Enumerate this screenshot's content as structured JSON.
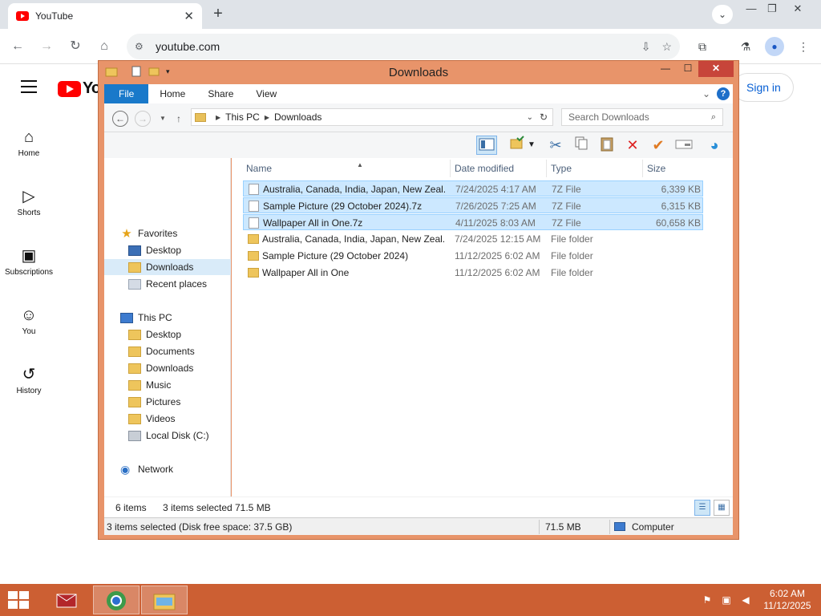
{
  "browser": {
    "tab_title": "YouTube",
    "url": "youtube.com"
  },
  "youtube": {
    "logo_text": "Yo",
    "sidebar": [
      {
        "icon": "home-icon",
        "label": "Home"
      },
      {
        "icon": "shorts-icon",
        "label": "Shorts"
      },
      {
        "icon": "subscriptions-icon",
        "label": "Subscriptions"
      },
      {
        "icon": "you-icon",
        "label": "You"
      },
      {
        "icon": "history-icon",
        "label": "History"
      }
    ],
    "signin_label": "Sign in"
  },
  "explorer": {
    "title": "Downloads",
    "ribbon_tabs": [
      "File",
      "Home",
      "Share",
      "View"
    ],
    "breadcrumb": [
      "This PC",
      "Downloads"
    ],
    "search_placeholder": "Search Downloads",
    "nav": {
      "favorites": "Favorites",
      "favorites_items": [
        "Desktop",
        "Downloads",
        "Recent places"
      ],
      "this_pc": "This PC",
      "pc_items": [
        "Desktop",
        "Documents",
        "Downloads",
        "Music",
        "Pictures",
        "Videos",
        "Local Disk (C:)"
      ],
      "network": "Network"
    },
    "columns": [
      "Name",
      "Date modified",
      "Type",
      "Size"
    ],
    "files": [
      {
        "name": "Australia, Canada, India, Japan, New Zeal...",
        "date": "7/24/2025 4:17 AM",
        "type": "7Z File",
        "size": "6,339 KB",
        "kind": "file",
        "selected": true
      },
      {
        "name": "Sample Picture (29 October 2024).7z",
        "date": "7/26/2025 7:25 AM",
        "type": "7Z File",
        "size": "6,315 KB",
        "kind": "file",
        "selected": true
      },
      {
        "name": "Wallpaper All in One.7z",
        "date": "4/11/2025 8:03 AM",
        "type": "7Z File",
        "size": "60,658 KB",
        "kind": "file",
        "selected": true
      },
      {
        "name": "Australia, Canada, India, Japan, New Zeal...",
        "date": "7/24/2025 12:15 AM",
        "type": "File folder",
        "size": "",
        "kind": "folder",
        "selected": false
      },
      {
        "name": "Sample Picture (29 October 2024)",
        "date": "11/12/2025 6:02 AM",
        "type": "File folder",
        "size": "",
        "kind": "folder",
        "selected": false
      },
      {
        "name": "Wallpaper All in One",
        "date": "11/12/2025 6:02 AM",
        "type": "File folder",
        "size": "",
        "kind": "folder",
        "selected": false
      }
    ],
    "status": {
      "item_count": "6 items",
      "selected": "3 items selected",
      "selected_size": "71.5 MB"
    },
    "infobar": {
      "details": "3 items selected (Disk free space: 37.5 GB)",
      "size": "71.5 MB",
      "location": "Computer"
    }
  },
  "taskbar": {
    "time": "6:02 AM",
    "date": "11/12/2025"
  }
}
